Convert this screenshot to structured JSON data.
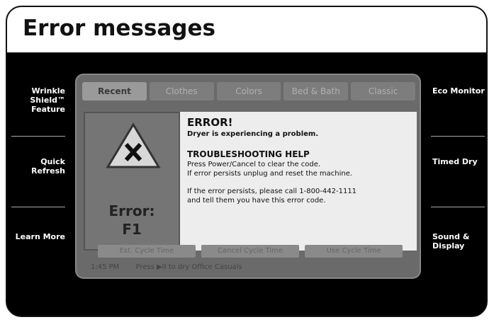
{
  "page": {
    "title": "Error messages"
  },
  "left_buttons": [
    {
      "label": "Wrinkle Shield™ Feature"
    },
    {
      "label": "Quick Refresh"
    },
    {
      "label": "Learn More"
    }
  ],
  "right_buttons": [
    {
      "label": "Eco Monitor"
    },
    {
      "label": "Timed Dry"
    },
    {
      "label": "Sound & Display"
    }
  ],
  "tabs": [
    {
      "label": "Recent"
    },
    {
      "label": "Clothes"
    },
    {
      "label": "Colors"
    },
    {
      "label": "Bed & Bath"
    },
    {
      "label": "Classic"
    }
  ],
  "bottom_buttons": [
    {
      "label": "Est. Cycle Time"
    },
    {
      "label": "Cancel Cycle Time"
    },
    {
      "label": "Use Cycle Time"
    }
  ],
  "status": {
    "time": "1:45 PM",
    "message": "Press ▶II to dry Office Casuals"
  },
  "error": {
    "code_label": "Error:",
    "code": "F1",
    "title": "ERROR!",
    "subtitle": "Dryer is experiencing a problem.",
    "help_title": "TROUBLESHOOTING HELP",
    "help_line1": "Press Power/Cancel to clear the code.",
    "help_line2": "If error persists unplug and reset the machine.",
    "call_line1": "If the error persists, please call 1-800-442-1111",
    "call_line2": "and tell them you have this error code."
  }
}
